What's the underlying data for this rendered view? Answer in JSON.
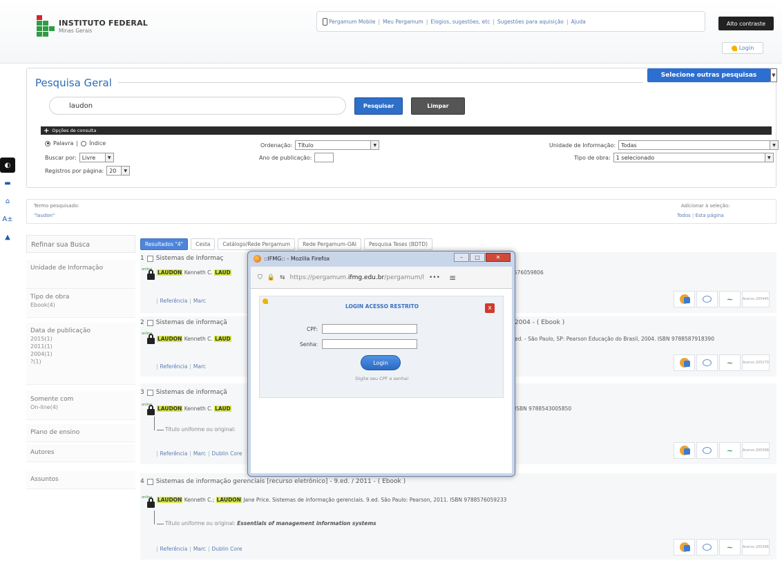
{
  "header": {
    "logo_name": "INSTITUTO FEDERAL",
    "logo_sub": "Minas Gerais",
    "nav": [
      "Pergamum Mobile",
      "Meu Pergamum",
      "Elogios, sugestões, etc",
      "Sugestões para aquisição",
      "Ajuda"
    ],
    "contrast_label": "Alto contraste",
    "login_label": "Login"
  },
  "accessibility": {
    "font_label": "A±"
  },
  "search": {
    "title": "Pesquisa Geral",
    "other_search_label": "Selecione outras pesquisas",
    "query": "laudon",
    "search_button": "Pesquisar",
    "clear_button": "Limpar",
    "options_title": "Opções de consulta",
    "radio_palavra": "Palavra",
    "radio_indice": "Índice",
    "buscar_por_label": "Buscar por:",
    "buscar_por_value": "Livre",
    "registros_label": "Registros por página:",
    "registros_value": "20",
    "ordenacao_label": "Ordenação:",
    "ordenacao_value": "Título",
    "ano_label": "Ano de publicação:",
    "unidade_label": "Unidade de Informação:",
    "unidade_value": "Todas",
    "tipo_label": "Tipo de obra:",
    "tipo_value": "1 selecionado"
  },
  "termo": {
    "label": "Termo pesquisado:",
    "value": "\"laudon\"",
    "select_label": "Adicionar à seleção:",
    "select_all": "Todos",
    "select_page": "Esta página"
  },
  "refine": {
    "title": "Refinar sua Busca",
    "items": [
      {
        "label": "Unidade de Informação",
        "values": ""
      },
      {
        "label": "Tipo de obra",
        "values": "Ebook(4)"
      },
      {
        "label": "Data de publicação",
        "values": "2015(1)\n2011(1)\n2004(1)\n?(1)"
      },
      {
        "label": "Somente com",
        "values": "On-line(4)"
      },
      {
        "label": "Plano de ensino",
        "values": ""
      },
      {
        "label": "Autores",
        "values": ""
      },
      {
        "label": "Assuntos",
        "values": ""
      }
    ]
  },
  "tabs": [
    "Resultados \"4\"",
    "Cesta",
    "Catálogo/Rede Pergamum",
    "Rede Pergamum-OAI",
    "Pesquisa Teses (BDTD)"
  ],
  "results": [
    {
      "num": "1",
      "title": "Sistemas de Informaç",
      "author_hl": "LAUDON",
      "author_rest": "Kenneth C.",
      "author_hl2": "LAUD",
      "ref": "8576059806",
      "link1": "Referência",
      "link2": "Marc",
      "acervo": "Acervo 205445"
    },
    {
      "num": "2",
      "title": "Sistemas de informaçã",
      "title_right": "2004 - ( Ebook )",
      "author_hl": "LAUDON",
      "author_rest": "Kenneth C.",
      "author_hl2": "LAUD",
      "ref": "ed. - São Paulo, SP: Pearson Educação do Brasil, 2004. ISBN 9788587918390",
      "link1": "Referência",
      "link2": "Marc",
      "acervo": "Acervo 205270"
    },
    {
      "num": "3",
      "title": "Sistemas de informaçã",
      "author_hl": "LAUDON",
      "author_rest": "Kenneth C.",
      "author_hl2": "LAUD",
      "ref": "ISBN 9788543005850",
      "uniform": "Título uniforme ou original:",
      "link1": "Referência",
      "link2": "Marc",
      "link3": "Dublin Core",
      "acervo": "Acervo 205368"
    },
    {
      "num": "4",
      "title": "Sistemas de informação gerenciais [recurso eletrônico] - 9.ed. / 2011 - ( Ebook )",
      "author_hl": "LAUDON",
      "author_rest": "Kenneth C.;",
      "author_hl2": "LAUDON",
      "ref": "Jane Price. Sistemas de informação gerenciais. 9.ed. São Paulo: Pearson, 2011. ISBN 9788576059233",
      "uniform": "Título uniforme ou original:",
      "uniform_value": "Essentials of management information systems",
      "link1": "Referência",
      "link2": "Marc",
      "link3": "Dublin Core",
      "acervo": "Acervo 205366"
    }
  ],
  "popup": {
    "window_title": "::IFMG:: - Mozilla Firefox",
    "url_prefix": "https://pergamum.",
    "url_domain": "ifmg.edu.br",
    "url_suffix": "/pergamum/l",
    "url_more": "•••",
    "login_title": "LOGIN ACESSO RESTRITO",
    "cpf_label": "CPF:",
    "senha_label": "Senha:",
    "login_button": "Login",
    "hint": "Digite seu CPF e senha!",
    "close_x": "x"
  }
}
